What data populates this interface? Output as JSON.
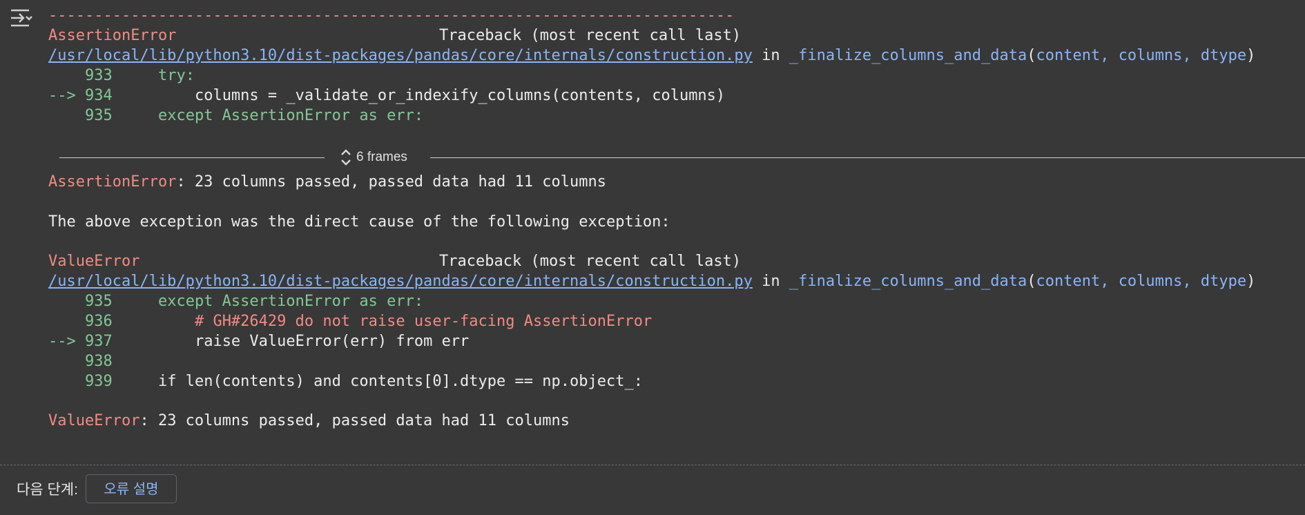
{
  "toolbar": {
    "output_icon": "output-toggle-icon"
  },
  "traceback": {
    "separator": "---------------------------------------------------------------------------",
    "first": {
      "error_type": "AssertionError",
      "header_right": "Traceback (most recent call last)",
      "file_path": "/usr/local/lib/python3.10/dist-packages/pandas/core/internals/construction.py",
      "in_text": " in ",
      "func_name": "_finalize_columns_and_data",
      "func_args_open": "(",
      "func_args": "content, columns, dtype",
      "func_args_close": ")",
      "lines": [
        {
          "marker": "    ",
          "num": "933",
          "code": "try:"
        },
        {
          "marker": "--> ",
          "num": "934",
          "code": "columns = _validate_or_indexify_columns(contents, columns)"
        },
        {
          "marker": "    ",
          "num": "935",
          "code": "except AssertionError as err:"
        }
      ]
    },
    "frames_label": "6 frames",
    "first_message_type": "AssertionError",
    "first_message_text": ": 23 columns passed, passed data had 11 columns",
    "cause_text": "The above exception was the direct cause of the following exception:",
    "second": {
      "error_type": "ValueError",
      "header_right": "Traceback (most recent call last)",
      "file_path": "/usr/local/lib/python3.10/dist-packages/pandas/core/internals/construction.py",
      "in_text": " in ",
      "func_name": "_finalize_columns_and_data",
      "func_args_open": "(",
      "func_args": "content, columns, dtype",
      "func_args_close": ")",
      "lines": [
        {
          "marker": "    ",
          "num": "935",
          "code": "except AssertionError as err:"
        },
        {
          "marker": "    ",
          "num": "936",
          "code": "# GH#26429 do not raise user-facing AssertionError"
        },
        {
          "marker": "--> ",
          "num": "937",
          "code": "raise ValueError(err) from err"
        },
        {
          "marker": "    ",
          "num": "938",
          "code": ""
        },
        {
          "marker": "    ",
          "num": "939",
          "code": "if len(contents) and contents[0].dtype == np.object_:"
        }
      ]
    },
    "final_message_type": "ValueError",
    "final_message_text": ": 23 columns passed, passed data had 11 columns"
  },
  "footer": {
    "next_steps_label": "다음 단계:",
    "explain_button": "오류 설명"
  },
  "colors": {
    "background": "#383838",
    "error": "#f28b82",
    "keyword": "#81c995",
    "link": "#8ab4f8",
    "text": "#ececec"
  }
}
